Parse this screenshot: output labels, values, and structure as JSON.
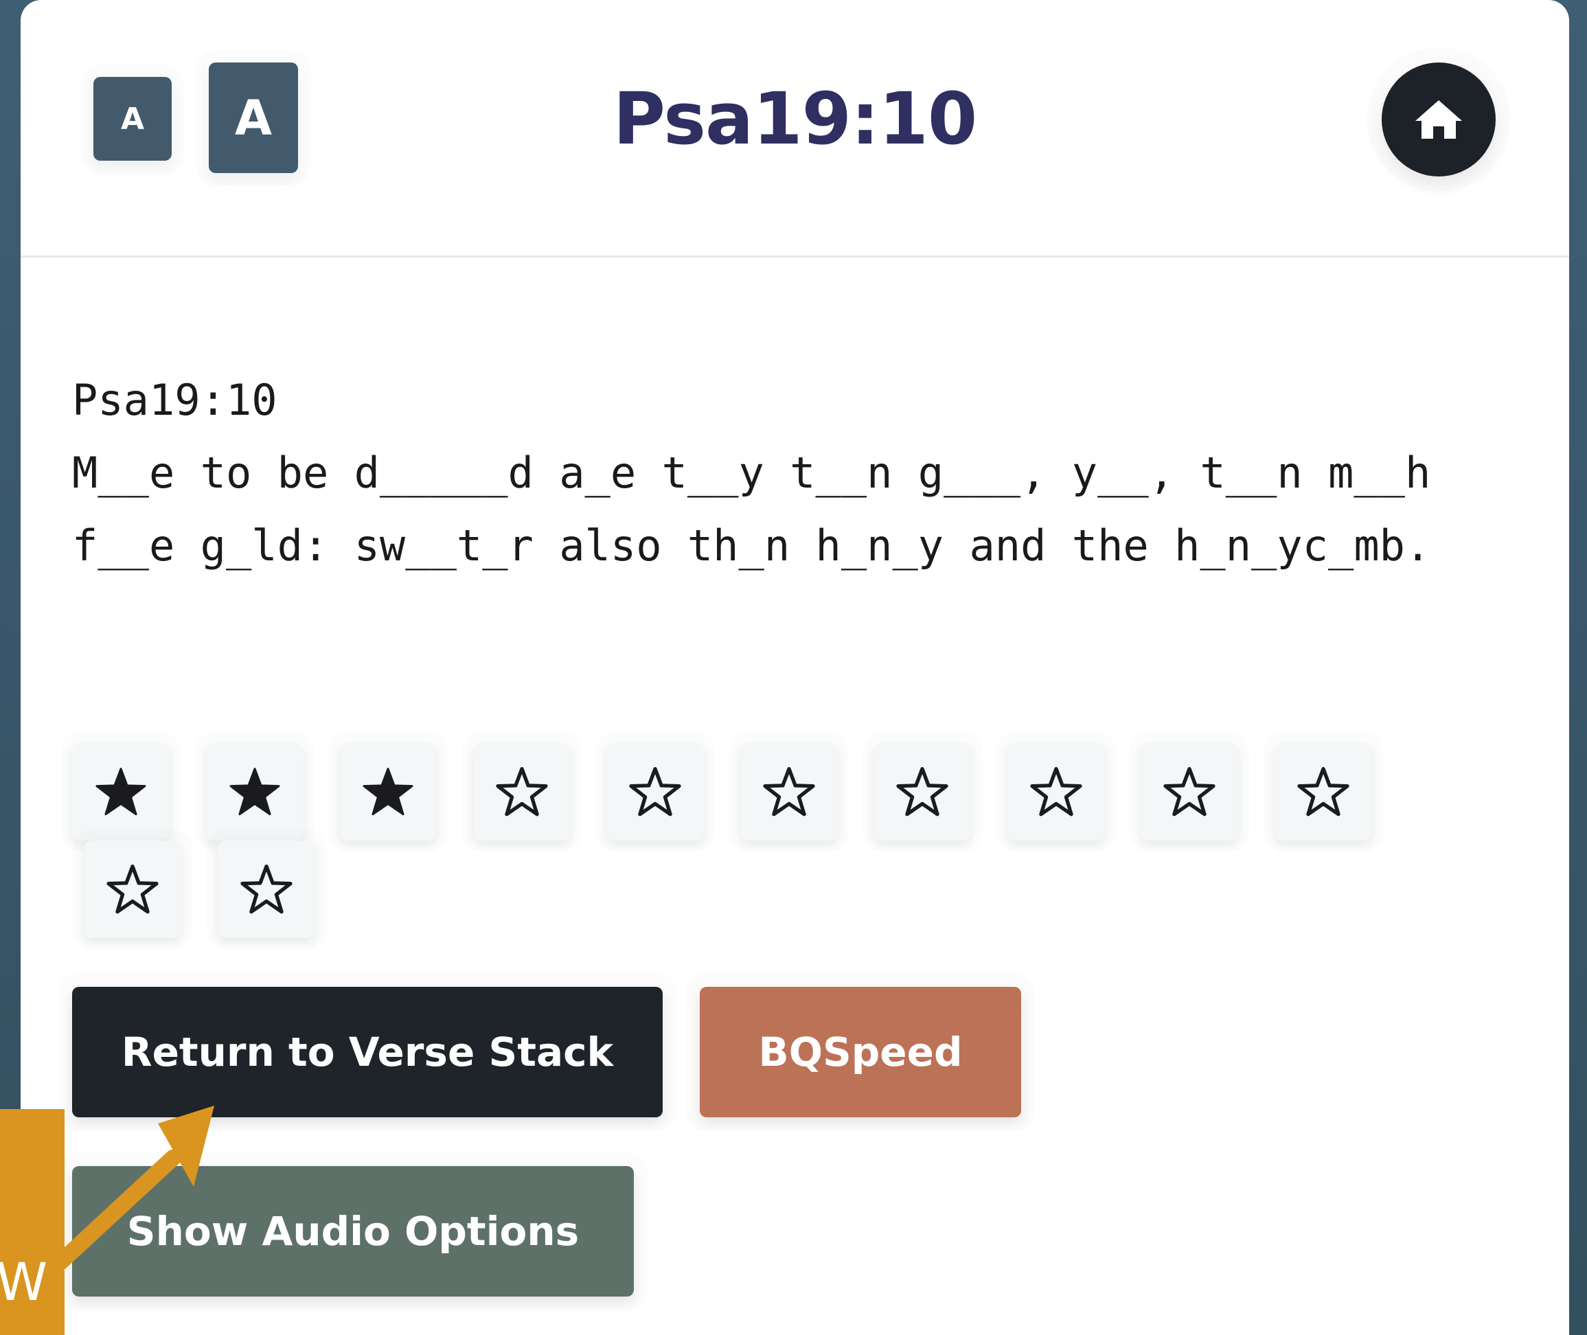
{
  "header": {
    "font_small_label": "A",
    "font_large_label": "A",
    "title": "Psa19:10"
  },
  "verse": {
    "reference": "Psa19:10",
    "text": "M__e to be d_____d a_e t__y t__n g___, y__, t__n m__h f__e g_ld: sw__t_r also th_n h_n_y and the h_n_yc_mb."
  },
  "rating": {
    "filled": 3,
    "total": 12
  },
  "buttons": {
    "return_label": "Return to Verse Stack",
    "speed_label": "BQSpeed",
    "audio_label": "Show Audio Options"
  },
  "annotation": {
    "letter": "W"
  },
  "colors": {
    "title": "#2f2f61",
    "font_button": "#435a6c",
    "home_button": "#1d2128",
    "return_button": "#1f232a",
    "speed_button": "#bc7256",
    "audio_button": "#5e7168",
    "annotation": "#d9951f"
  }
}
